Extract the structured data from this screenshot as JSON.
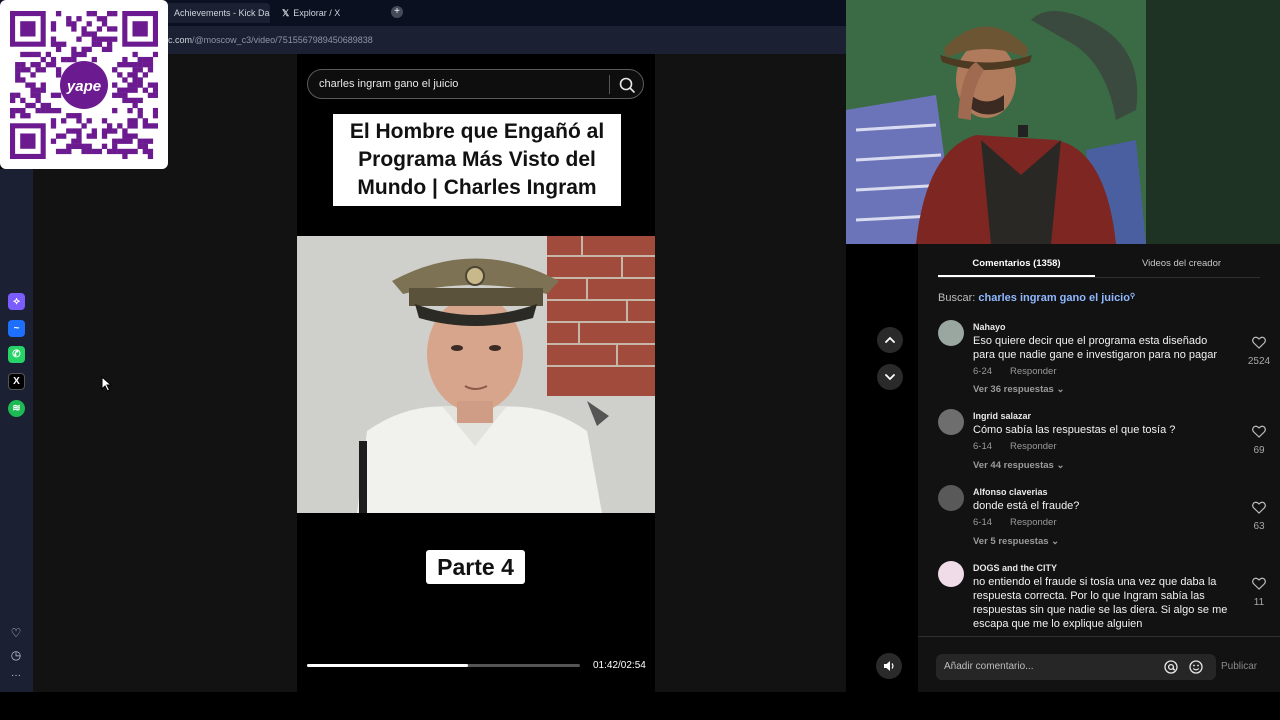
{
  "browser": {
    "tabs": [
      {
        "label": "Achievements - Kick Dash"
      },
      {
        "label": "Explorar / X"
      }
    ],
    "new_tab_glyph": "+",
    "url_prefix": "c.com",
    "url_path": "/@moscow_c3/video/7515567989450689838"
  },
  "qr": {
    "brand_text": "yape",
    "brand_color": "#6b1b8f"
  },
  "sidebar": {
    "apps": [
      {
        "name": "appflowy-icon",
        "color": "#7a5cff",
        "glyph": "⟡"
      },
      {
        "name": "messenger-icon",
        "color": "#1f6fff",
        "glyph": "~"
      },
      {
        "name": "whatsapp-icon",
        "color": "#25d366",
        "glyph": "✆"
      },
      {
        "name": "x-icon",
        "color": "#000000",
        "glyph": "X"
      },
      {
        "name": "spotify-icon",
        "color": "#1db954",
        "glyph": "≋"
      }
    ],
    "bottom": [
      {
        "name": "heart-icon",
        "glyph": "♡"
      },
      {
        "name": "clock-icon",
        "glyph": "◷"
      },
      {
        "name": "more-icon",
        "glyph": "···"
      }
    ]
  },
  "video": {
    "search_query": "charles ingram gano el juicio",
    "title_lines": [
      "El Hombre que Engañó al",
      "Programa Más Visto del",
      "Mundo | Charles Ingram"
    ],
    "part_label": "Parte 4",
    "progress": 0.59,
    "time": "01:42/02:54"
  },
  "comments": {
    "tab_comments": "Comentarios (1358)",
    "tab_creator": "Videos del creador",
    "buscar_label": "Buscar:",
    "buscar_query": "charles ingram gano el juicio",
    "items": [
      {
        "user": "Nahayo",
        "text": "Eso quiere decir que el programa esta diseñado para que nadie gane e investigaron para no pagar",
        "date": "6-24",
        "reply": "Responder",
        "more": "Ver 36 respuestas",
        "likes": "2524",
        "avatar_color": "#9aa6a0"
      },
      {
        "user": "Ingrid salazar",
        "text": "Cómo sabía las respuestas el que tosía ?",
        "date": "6-14",
        "reply": "Responder",
        "more": "Ver 44 respuestas",
        "likes": "69",
        "avatar_color": "#6e6e6e"
      },
      {
        "user": "Alfonso claverias",
        "text": "donde está el fraude?",
        "date": "6-14",
        "reply": "Responder",
        "more": "Ver 5 respuestas",
        "likes": "63",
        "avatar_color": "#595959"
      },
      {
        "user": "DOGS and the CITY",
        "text": "no entiendo el fraude si tosía una vez que daba la respuesta correcta. Por lo que Ingram sabía las respuestas sin que nadie se las diera. Si algo se me escapa que me lo explique alguien",
        "likes": "11",
        "avatar_color": "#f0dbe8"
      }
    ],
    "input_placeholder": "Añadir comentario...",
    "publish_label": "Publicar"
  }
}
